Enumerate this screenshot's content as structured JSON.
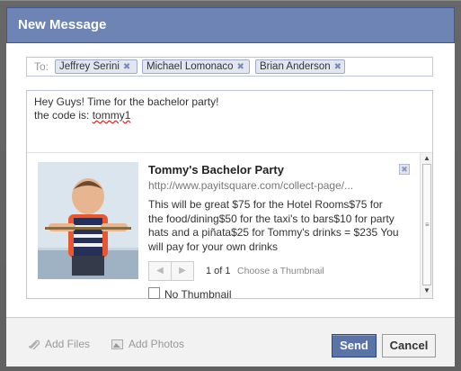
{
  "dialog": {
    "title": "New Message"
  },
  "to": {
    "label": "To:",
    "recipients": [
      {
        "name": "Jeffrey Serini"
      },
      {
        "name": "Michael Lomonaco"
      },
      {
        "name": "Brian Anderson"
      }
    ],
    "remove_glyph": "✖"
  },
  "message": {
    "line1": "Hey Guys!  Time for the bachelor party!",
    "line2_prefix": "the code is: ",
    "code": "tommy1"
  },
  "attachment": {
    "title": "Tommy's Bachelor Party",
    "url": "http://www.payitsquare.com/collect-page/...",
    "description": "This will be great $75 for the Hotel Rooms$75 for the food/dining$50 for the taxi's to bars$10 for party hats and a piñata$25 for Tommy's drinks = $235 You will pay for your own drinks",
    "prev_label": "◀",
    "next_label": "▶",
    "page_count": "1 of 1",
    "choose_thumbnail": "Choose a Thumbnail",
    "no_thumbnail_label": "No Thumbnail",
    "no_thumbnail_checked": false,
    "close_glyph": "✖"
  },
  "scroll": {
    "up": "▲",
    "down": "▼",
    "grip": "≡"
  },
  "footer": {
    "add_files": "Add Files",
    "add_photos": "Add Photos",
    "send": "Send",
    "cancel": "Cancel"
  },
  "icons": {
    "paperclip": "paperclip-icon",
    "photo": "photo-icon"
  },
  "colors": {
    "titlebar": "#6d84b4",
    "send_button": "#5b74a8"
  }
}
